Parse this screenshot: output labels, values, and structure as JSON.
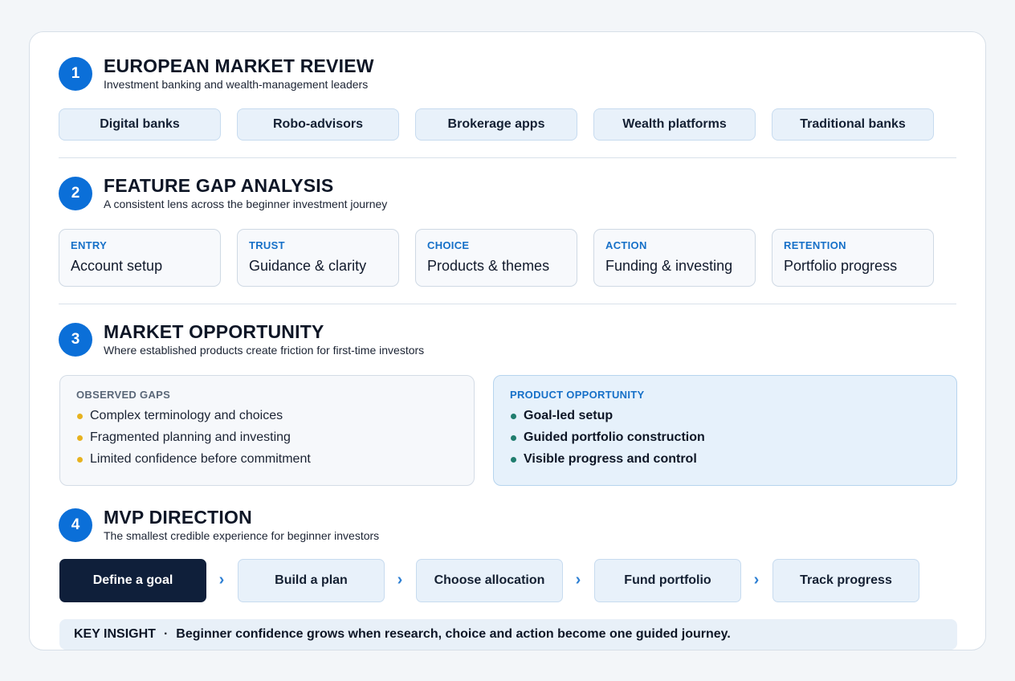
{
  "sections": [
    {
      "number": "1",
      "title": "EUROPEAN MARKET REVIEW",
      "subtitle": "Investment banking and wealth-management leaders"
    },
    {
      "number": "2",
      "title": "FEATURE GAP ANALYSIS",
      "subtitle": "A consistent lens across the beginner investment journey"
    },
    {
      "number": "3",
      "title": "MARKET OPPORTUNITY",
      "subtitle": "Where established products create friction for first-time investors"
    },
    {
      "number": "4",
      "title": "MVP DIRECTION",
      "subtitle": "The smallest credible experience for beginner investors"
    }
  ],
  "market_segments": [
    "Digital banks",
    "Robo-advisors",
    "Brokerage apps",
    "Wealth platforms",
    "Traditional banks"
  ],
  "journey_stages": [
    {
      "label": "ENTRY",
      "text": "Account setup"
    },
    {
      "label": "TRUST",
      "text": "Guidance & clarity"
    },
    {
      "label": "CHOICE",
      "text": "Products & themes"
    },
    {
      "label": "ACTION",
      "text": "Funding & investing"
    },
    {
      "label": "RETENTION",
      "text": "Portfolio progress"
    }
  ],
  "observed_gaps": {
    "title": "OBSERVED GAPS",
    "items": [
      "Complex terminology and choices",
      "Fragmented planning and investing",
      "Limited confidence before commitment"
    ]
  },
  "product_opportunity": {
    "title": "PRODUCT OPPORTUNITY",
    "items": [
      "Goal-led setup",
      "Guided portfolio construction",
      "Visible progress and control"
    ]
  },
  "mvp_flow": [
    "Define a goal",
    "Build a plan",
    "Choose allocation",
    "Fund portfolio",
    "Track progress"
  ],
  "flow_arrow": "›",
  "key_insight": {
    "label": "KEY INSIGHT",
    "separator": "·",
    "text": "Beginner confidence grows when research, choice and action become one guided journey."
  },
  "colors": {
    "accent": "#0b6fd8",
    "active_step": "#0f1f3a",
    "chip_fill": "#e8f1fa",
    "gap_bullet": "#e7b21f",
    "opportunity_bullet": "#1f7d6e"
  }
}
